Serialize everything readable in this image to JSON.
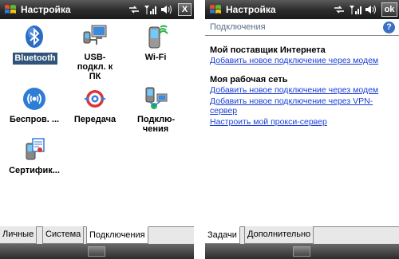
{
  "left": {
    "title": "Настройка",
    "close_label": "X",
    "icons": [
      {
        "id": "bluetooth",
        "label": "Bluetooth",
        "icon": "bluetooth-icon"
      },
      {
        "id": "usb",
        "label": "USB-подкл. к ПК",
        "icon": "usb-pc-icon"
      },
      {
        "id": "wifi",
        "label": "Wi-Fi",
        "icon": "wifi-icon"
      },
      {
        "id": "wireless",
        "label": "Беспров. ...",
        "icon": "wireless-icon"
      },
      {
        "id": "beam",
        "label": "Передача",
        "icon": "beam-icon"
      },
      {
        "id": "connections",
        "label": "Подклю-чения",
        "icon": "connections-icon"
      },
      {
        "id": "certs",
        "label": "Сертифик...",
        "icon": "certificates-icon"
      }
    ],
    "tabs": [
      "Личные",
      "Система",
      "Подключения"
    ],
    "active_tab": "Подключения"
  },
  "right": {
    "title": "Настройка",
    "ok_label": "ok",
    "section_title": "Подключения",
    "help_label": "?",
    "groups": [
      {
        "title": "Мой поставщик Интернета",
        "links": [
          "Добавить новое подключение через модем"
        ]
      },
      {
        "title": "Моя рабочая сеть",
        "links": [
          "Добавить новое подключение через модем",
          "Добавить новое подключение через VPN-",
          "сервер",
          "Настроить мой прокси-сервер"
        ]
      }
    ],
    "tabs": [
      "Задачи",
      "Дополнительно"
    ],
    "active_tab": "Задачи"
  }
}
